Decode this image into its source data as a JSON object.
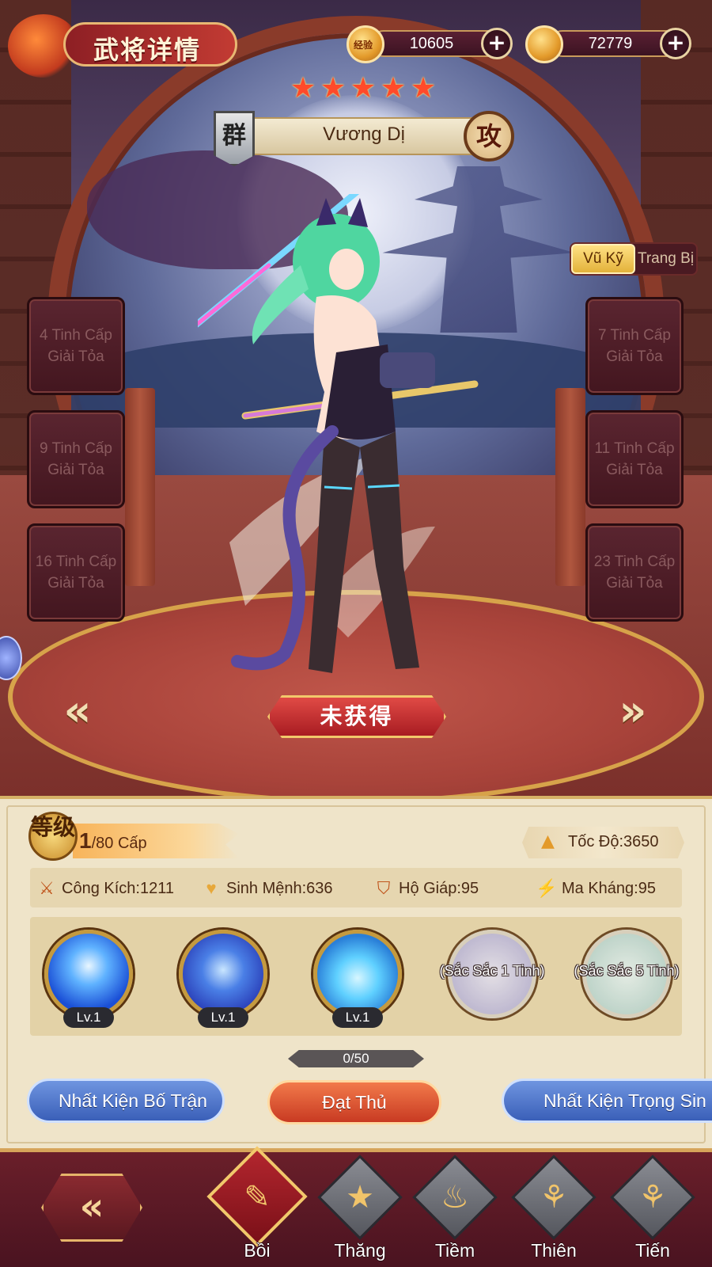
{
  "header": {
    "title": "武将详情",
    "exp": {
      "icon_label": "经验",
      "value": "10605"
    },
    "gold": {
      "value": "72779"
    }
  },
  "hero": {
    "stars": 5,
    "faction": "群",
    "name": "Vương Dị",
    "role": "攻",
    "status": "未获得"
  },
  "tabs": {
    "martial": "Vũ Kỹ",
    "equipment": "Trang Bị"
  },
  "slots": {
    "left": [
      {
        "line1": "4 Tinh Cấp",
        "line2": "Giải Tỏa"
      },
      {
        "line1": "9 Tinh Cấp",
        "line2": "Giải Tỏa"
      },
      {
        "line1": "16 Tinh Cấp",
        "line2": "Giải Tỏa"
      }
    ],
    "right": [
      {
        "line1": "7 Tinh Cấp",
        "line2": "Giải Tỏa"
      },
      {
        "line1": "11 Tinh Cấp",
        "line2": "Giải Tỏa"
      },
      {
        "line1": "23 Tinh Cấp",
        "line2": "Giải Tỏa"
      }
    ]
  },
  "level": {
    "badge": "等级",
    "current": "1",
    "max": "/80 Cấp"
  },
  "stats": {
    "speed": "Tốc Độ:3650",
    "attack": "Công Kích:1211",
    "hp": "Sinh Mệnh:636",
    "armor": "Hộ Giáp:95",
    "magic_resist": "Ma Kháng:95"
  },
  "skills": [
    {
      "level": "Lv.1",
      "color": "#1a4fd6"
    },
    {
      "level": "Lv.1",
      "color": "#2a3fb8"
    },
    {
      "level": "Lv.1",
      "color": "#2a7fd8"
    },
    {
      "locked_text": "(Sắc Sắc 1 Tinh)",
      "color": "#b9b5d8"
    },
    {
      "locked_text": "(Sắc Sắc 5 Tinh)",
      "color": "#b9d5d0"
    }
  ],
  "fragments": {
    "text": "0/50",
    "progress": 0
  },
  "actions": {
    "formation": "Nhất Kiện Bố Trận",
    "obtain": "Đạt Thủ",
    "rebirth": "Nhất Kiện Trọng Sin"
  },
  "nav": {
    "items": [
      {
        "label": "Bồi",
        "icon": "cultivate-icon",
        "active": true
      },
      {
        "label": "Thăng",
        "icon": "star-icon",
        "active": false
      },
      {
        "label": "Tiềm",
        "icon": "flame-icon",
        "active": false
      },
      {
        "label": "Thiên",
        "icon": "branch-icon",
        "active": false
      },
      {
        "label": "Tiến",
        "icon": "branch-icon",
        "active": false
      }
    ]
  },
  "colors": {
    "accent_gold": "#d6a45a",
    "panel_bg": "#efe4c9",
    "nav_bg": "#6a1f2a"
  }
}
